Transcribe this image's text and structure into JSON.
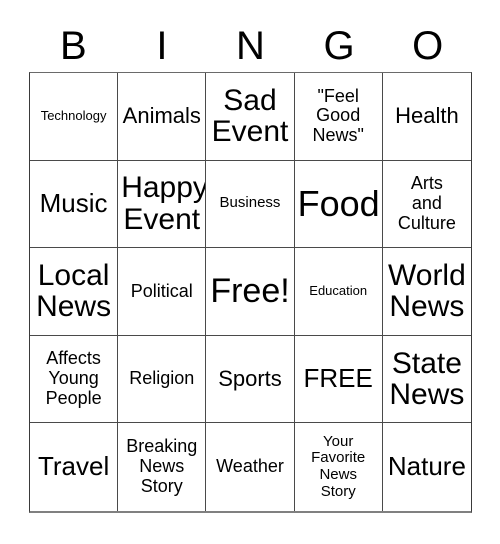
{
  "card": {
    "title_letters": [
      "B",
      "I",
      "N",
      "G",
      "O"
    ],
    "columns": 5,
    "rows": 5,
    "text_color": "#000000",
    "background_color": "#ffffff",
    "border_color": "#4a4a4a"
  },
  "cells": [
    {
      "label": "Technology",
      "size": "fs-xs"
    },
    {
      "label": "Animals",
      "size": "fs-l"
    },
    {
      "label": "Sad\nEvent",
      "size": "fs-xxl"
    },
    {
      "label": "\"Feel\nGood\nNews\"",
      "size": "fs-m"
    },
    {
      "label": "Health",
      "size": "fs-l"
    },
    {
      "label": "Music",
      "size": "fs-xl"
    },
    {
      "label": "Happy\nEvent",
      "size": "fs-xxl"
    },
    {
      "label": "Business",
      "size": "fs-s"
    },
    {
      "label": "Food",
      "size": "fs-4xl"
    },
    {
      "label": "Arts\nand\nCulture",
      "size": "fs-m"
    },
    {
      "label": "Local\nNews",
      "size": "fs-xxl"
    },
    {
      "label": "Political",
      "size": "fs-m"
    },
    {
      "label": "Free!",
      "size": "fs-3xl"
    },
    {
      "label": "Education",
      "size": "fs-xs"
    },
    {
      "label": "World\nNews",
      "size": "fs-xxl"
    },
    {
      "label": "Affects\nYoung\nPeople",
      "size": "fs-m"
    },
    {
      "label": "Religion",
      "size": "fs-m"
    },
    {
      "label": "Sports",
      "size": "fs-l"
    },
    {
      "label": "FREE",
      "size": "fs-xl"
    },
    {
      "label": "State\nNews",
      "size": "fs-xxl"
    },
    {
      "label": "Travel",
      "size": "fs-xl"
    },
    {
      "label": "Breaking\nNews\nStory",
      "size": "fs-m"
    },
    {
      "label": "Weather",
      "size": "fs-m"
    },
    {
      "label": "Your\nFavorite\nNews\nStory",
      "size": "fs-s"
    },
    {
      "label": "Nature",
      "size": "fs-xl"
    }
  ]
}
